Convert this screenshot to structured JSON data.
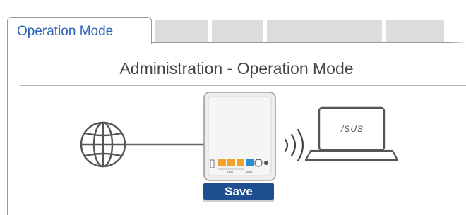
{
  "tabs": {
    "active_label": "Operation Mode",
    "inactive": [
      "",
      "",
      "",
      ""
    ]
  },
  "page": {
    "title": "Administration - Operation Mode"
  },
  "diagram": {
    "laptop_brand": "/SUS",
    "port_labels": [
      "LAN",
      "WAN"
    ],
    "icons": [
      "globe-icon",
      "router-icon",
      "wifi-signal-icon",
      "laptop-icon"
    ],
    "port_colors": {
      "lan": "#f2a12b",
      "wan": "#2b8cd6"
    }
  },
  "actions": {
    "save_label": "Save"
  },
  "colors": {
    "accent_blue": "#2b63b5",
    "button_blue": "#1f4f91",
    "inactive_tab": "#dcdcdc"
  }
}
